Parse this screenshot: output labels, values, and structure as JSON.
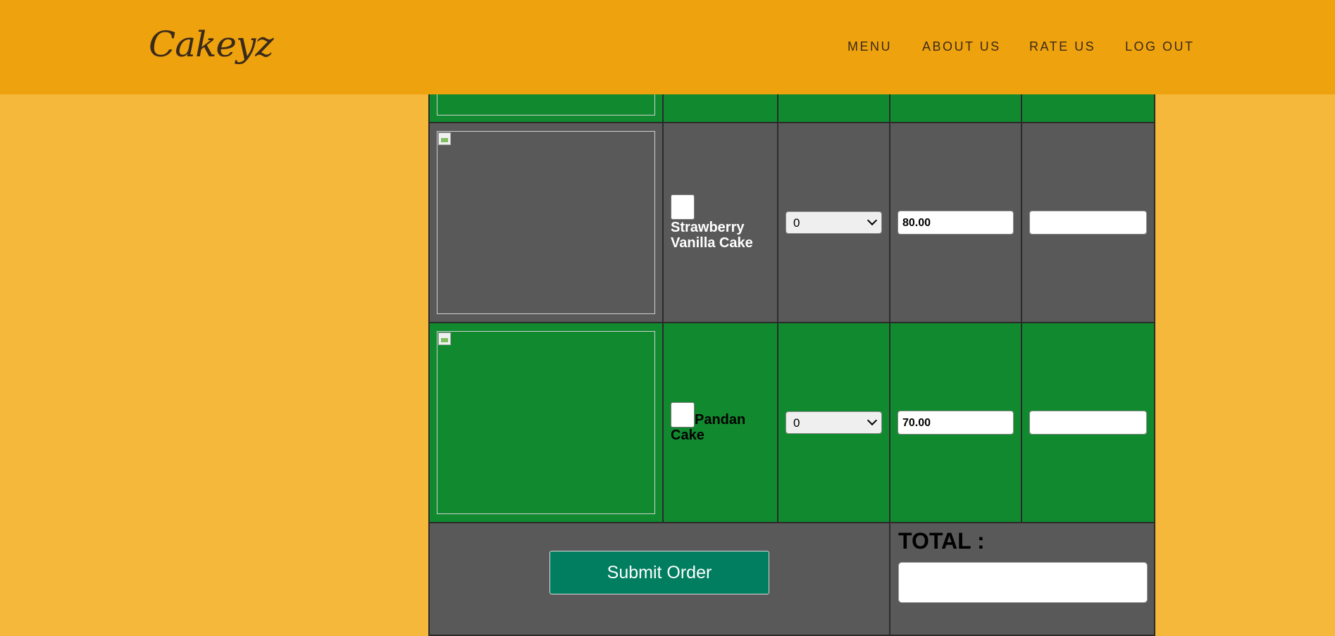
{
  "header": {
    "logo": "Cakeyz",
    "nav": [
      "MENU",
      "ABOUT US",
      "RATE US",
      "LOG OUT"
    ]
  },
  "items": [
    {
      "name": "Strawberry Vanilla Cake",
      "quantity": "0",
      "price": "80.00",
      "subtotal": ""
    },
    {
      "name": "Pandan Cake",
      "quantity": "0",
      "price": "70.00",
      "subtotal": ""
    }
  ],
  "footer": {
    "submit_label": "Submit Order",
    "total_label": "TOTAL :",
    "total_value": ""
  },
  "colors": {
    "page_background": "#f6b83b",
    "header_background": "#eea20e",
    "row_green": "#118a2f",
    "row_gray": "#595959",
    "submit_button": "#017d5f"
  }
}
